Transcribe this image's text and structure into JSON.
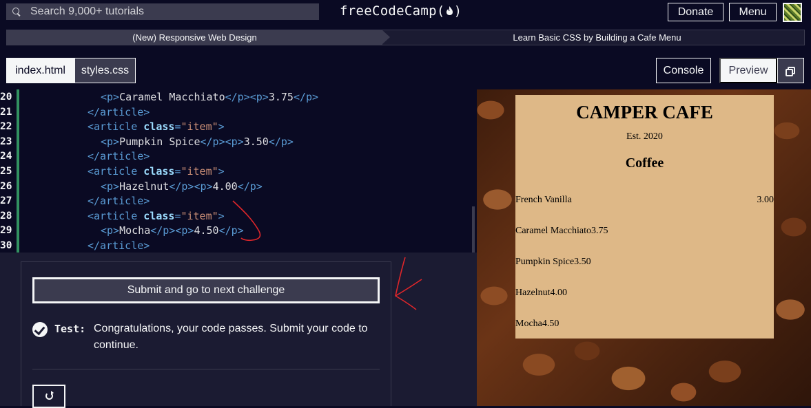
{
  "topbar": {
    "search_placeholder": "Search 9,000+ tutorials",
    "brand": "freeCodeCamp(🔥)",
    "brand_text": "freeCodeCamp(",
    "brand_close": ")",
    "donate_label": "Donate",
    "menu_label": "Menu"
  },
  "breadcrumb": {
    "course": "(New) Responsive Web Design",
    "project": "Learn Basic CSS by Building a Cafe Menu"
  },
  "file_tabs": [
    {
      "label": "index.html",
      "active": true
    },
    {
      "label": "styles.css",
      "active": false
    }
  ],
  "toolbar": {
    "console_label": "Console",
    "preview_label": "Preview"
  },
  "editor": {
    "lines": [
      {
        "num": "20",
        "parts": [
          [
            "tag",
            "<p>"
          ],
          [
            "txt",
            "Caramel Macchiato"
          ],
          [
            "tag",
            "</p><p>"
          ],
          [
            "txt",
            "3.75"
          ],
          [
            "tag",
            "</p>"
          ]
        ],
        "indent": "  "
      },
      {
        "num": "21",
        "parts": [
          [
            "tag",
            "</article>"
          ]
        ],
        "indent": ""
      },
      {
        "num": "22",
        "parts": [
          [
            "tag",
            "<article "
          ],
          [
            "attr",
            "class"
          ],
          [
            "tag",
            "="
          ],
          [
            "str",
            "\"item\""
          ],
          [
            "tag",
            ">"
          ]
        ],
        "indent": ""
      },
      {
        "num": "23",
        "parts": [
          [
            "tag",
            "<p>"
          ],
          [
            "txt",
            "Pumpkin Spice"
          ],
          [
            "tag",
            "</p><p>"
          ],
          [
            "txt",
            "3.50"
          ],
          [
            "tag",
            "</p>"
          ]
        ],
        "indent": "  "
      },
      {
        "num": "24",
        "parts": [
          [
            "tag",
            "</article>"
          ]
        ],
        "indent": ""
      },
      {
        "num": "25",
        "parts": [
          [
            "tag",
            "<article "
          ],
          [
            "attr",
            "class"
          ],
          [
            "tag",
            "="
          ],
          [
            "str",
            "\"item\""
          ],
          [
            "tag",
            ">"
          ]
        ],
        "indent": ""
      },
      {
        "num": "26",
        "parts": [
          [
            "tag",
            "<p>"
          ],
          [
            "txt",
            "Hazelnut"
          ],
          [
            "tag",
            "</p><p>"
          ],
          [
            "txt",
            "4.00"
          ],
          [
            "tag",
            "</p>"
          ]
        ],
        "indent": "  "
      },
      {
        "num": "27",
        "parts": [
          [
            "tag",
            "</article>"
          ]
        ],
        "indent": ""
      },
      {
        "num": "28",
        "parts": [
          [
            "tag",
            "<article "
          ],
          [
            "attr",
            "class"
          ],
          [
            "tag",
            "="
          ],
          [
            "str",
            "\"item\""
          ],
          [
            "tag",
            ">"
          ]
        ],
        "indent": ""
      },
      {
        "num": "29",
        "parts": [
          [
            "tag",
            "<p>"
          ],
          [
            "txt",
            "Mocha"
          ],
          [
            "tag",
            "</p><p>"
          ],
          [
            "txt",
            "4.50"
          ],
          [
            "tag",
            "</p>"
          ]
        ],
        "indent": "  "
      },
      {
        "num": "30",
        "parts": [
          [
            "tag",
            "</article>"
          ]
        ],
        "indent": ""
      }
    ]
  },
  "challenge": {
    "submit_label": "Submit and go to next challenge",
    "test_label": "Test:",
    "test_message": "Congratulations, your code passes. Submit your code to continue."
  },
  "preview": {
    "title": "CAMPER CAFE",
    "established": "Est. 2020",
    "section": "Coffee",
    "items": [
      {
        "name": "French Vanilla",
        "price": "3.00"
      },
      {
        "name": "Caramel Macchiato",
        "price": "3.75"
      },
      {
        "name": "Pumpkin Spice",
        "price": "3.50"
      },
      {
        "name": "Hazelnut",
        "price": "4.00"
      },
      {
        "name": "Mocha",
        "price": "4.50"
      }
    ]
  },
  "colors": {
    "background": "#0a0a23",
    "panel": "#1b1b32",
    "gray": "#3b3b4f",
    "card": "#deb887",
    "annotation": "#e0262a"
  }
}
